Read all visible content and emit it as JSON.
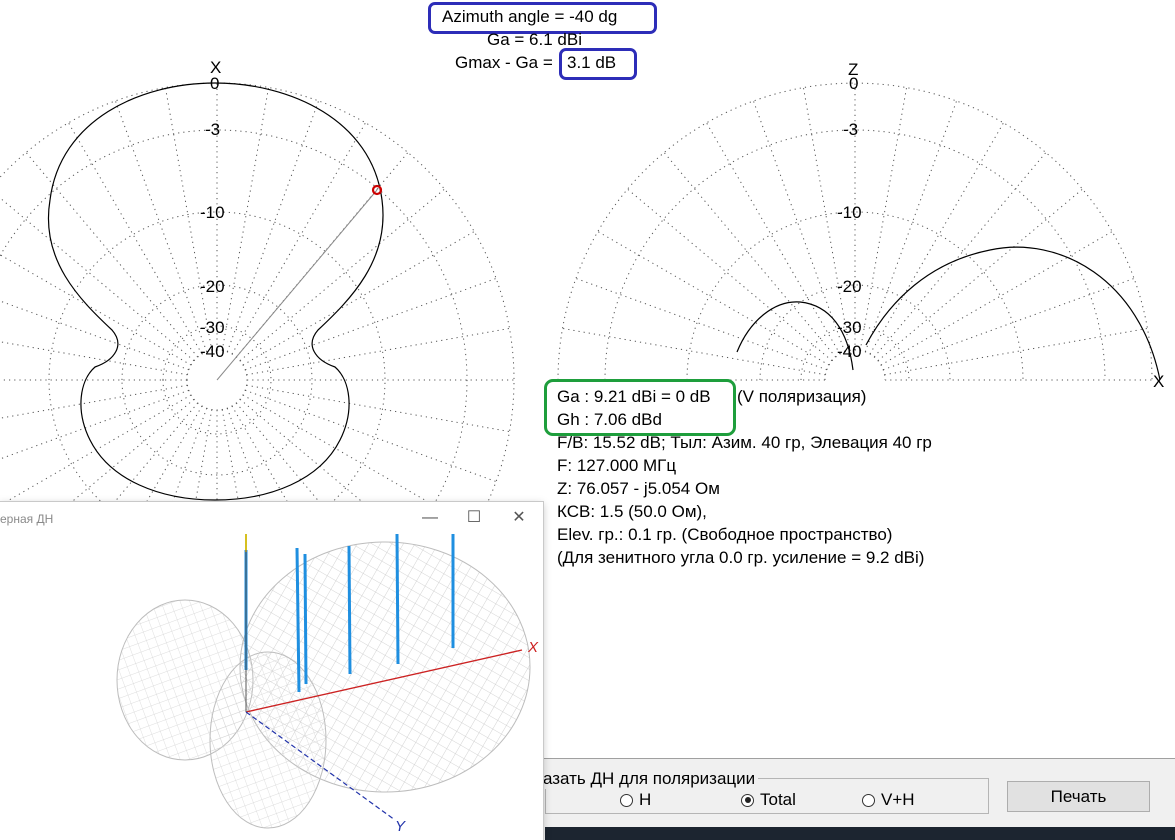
{
  "header": {
    "azimuth": "Azimuth angle = -40 dg",
    "ga": "Ga = 6.1 dBi",
    "gmax_prefix": "Gmax - Ga =",
    "gmax_value": "3.1 dB"
  },
  "left_plot": {
    "axis_label": "X",
    "ticks": [
      "0",
      "-3",
      "-10",
      "-20",
      "-30",
      "-40"
    ],
    "marker_azimuth_deg": -40
  },
  "right_plot": {
    "axis_label_top": "Z",
    "axis_label_right": "X",
    "ticks": [
      "0",
      "-3",
      "-10",
      "-20",
      "-30",
      "-40"
    ]
  },
  "info": {
    "ga_line": "Ga : 9.21 dBi = 0 dB",
    "polarization": "(V поляризация)",
    "gh_line": "Gh : 7.06 dBd",
    "fb_line": "F/B: 15.52 dB; Тыл: Азим. 40 гр, Элевация 40 гр",
    "freq_line": "F: 127.000 МГц",
    "z_line": "Z: 76.057 - j5.054 Ом",
    "swr_line": "КСВ: 1.5 (50.0 Ом),",
    "elev_line": "Elev. гр.: 0.1 гр. (Свободное пространство)",
    "zenith_line": "(Для зенитного угла 0.0 гр. усиление = 9.2 dBi)"
  },
  "controls": {
    "group_label": "азать ДН для поляризации",
    "radio_h": "H",
    "radio_total": "Total",
    "radio_vh": "V+H",
    "selected": "Total",
    "print_button": "Печать"
  },
  "window3d": {
    "title": "ерная ДН",
    "minimize_icon": "—",
    "maximize_icon": "☐",
    "close_icon": "✕",
    "axis_x": "X",
    "axis_y": "Y"
  },
  "colors": {
    "highlight_blue": "#2d2db8",
    "highlight_green": "#1e9e3c",
    "marker_red": "#cc0000",
    "mesh_gray": "#c8c8c8",
    "antenna_blue": "#1f8fe0"
  }
}
